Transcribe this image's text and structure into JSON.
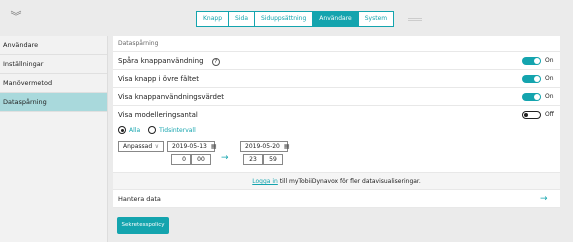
{
  "topbar": {
    "collapse_icon": "double-chevron-down-icon",
    "tabs": [
      {
        "label": "Knapp",
        "active": false
      },
      {
        "label": "Sida",
        "active": false
      },
      {
        "label": "Siduppsättning",
        "active": false
      },
      {
        "label": "Användare",
        "active": true
      },
      {
        "label": "System",
        "active": false
      }
    ]
  },
  "sidebar": {
    "items": [
      {
        "label": "Användare",
        "active": false
      },
      {
        "label": "Inställningar",
        "active": false
      },
      {
        "label": "Manövermetod",
        "active": false
      },
      {
        "label": "Dataspårning",
        "active": true
      }
    ]
  },
  "main": {
    "section_title": "Dataspårning",
    "rows": [
      {
        "label": "Spåra knappanvändning",
        "help": "?",
        "toggle": "On"
      },
      {
        "label": "Visa knapp i övre fältet",
        "toggle": "On"
      },
      {
        "label": "Visa knappanvändningsvärdet",
        "toggle": "On"
      },
      {
        "label": "Visa modelleringsantal",
        "toggle": "Off"
      }
    ],
    "range": {
      "option_all": "Alla",
      "option_interval": "Tidsintervall",
      "selected": "Alla",
      "preset": "Anpassad",
      "preset_caret": "∨",
      "start_date": "2019-05-13",
      "start_hour": "0",
      "start_minute": "00",
      "end_date": "2019-05-20",
      "end_hour": "23",
      "end_minute": "59",
      "calendar_glyph": "▦",
      "arrow": "→"
    },
    "login_link": "Logga in",
    "login_text": " till myTobiiDynavox för fler datavisualiseringar.",
    "manage_label": "Hantera data",
    "manage_arrow": "→",
    "privacy_button": "Sekretesspolicy"
  },
  "colors": {
    "accent": "#14a4ae",
    "sidebar_active": "#a9d9dc"
  }
}
